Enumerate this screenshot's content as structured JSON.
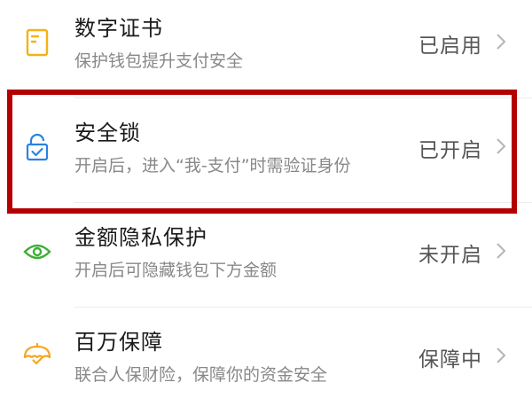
{
  "settings": {
    "items": [
      {
        "title": "数字证书",
        "subtitle": "保护钱包提升支付安全",
        "status": "已启用",
        "icon": "certificate-icon",
        "icon_color": "#F2B318"
      },
      {
        "title": "安全锁",
        "subtitle": "开启后，进入“我-支付”时需验证身份",
        "status": "已开启",
        "icon": "lock-icon",
        "icon_color": "#2A82E4"
      },
      {
        "title": "金额隐私保护",
        "subtitle": "开启后可隐藏钱包下方金额",
        "status": "未开启",
        "icon": "eye-icon",
        "icon_color": "#3CB034"
      },
      {
        "title": "百万保障",
        "subtitle": "联合人保财险，保障你的资金安全",
        "status": "保障中",
        "icon": "umbrella-icon",
        "icon_color": "#F5A623"
      }
    ]
  },
  "highlight": {
    "color": "#B40000",
    "target": "安全锁"
  }
}
